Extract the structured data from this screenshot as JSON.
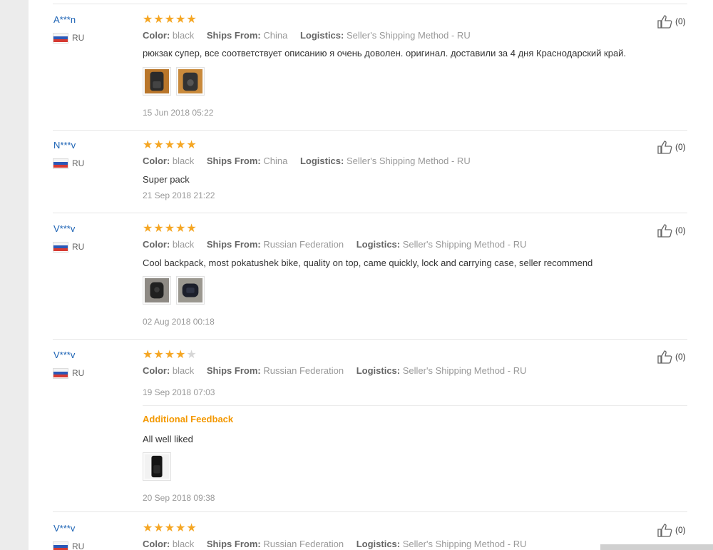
{
  "labels": {
    "color": "Color:",
    "ships_from": "Ships From:",
    "logistics": "Logistics:",
    "additional_feedback": "Additional Feedback"
  },
  "colors": {
    "star_on": "#f5a623",
    "star_off": "#d6d6d6",
    "username": "#1b62b4",
    "additional_feedback": "#f39800"
  },
  "reviews": [
    {
      "user": "A***n",
      "country": "RU",
      "rating": 5,
      "color": "black",
      "ships_from": "China",
      "logistics": "Seller's Shipping Method - RU",
      "text": "рюкзак супер, все соответствует описанию я очень доволен. оригинал. доставили за 4 дня Краснодарский край.",
      "photo_count": 2,
      "date": "15 Jun 2018 05:22",
      "helpful": "(0)"
    },
    {
      "user": "N***v",
      "country": "RU",
      "rating": 5,
      "color": "black",
      "ships_from": "China",
      "logistics": "Seller's Shipping Method - RU",
      "text": "Super pack",
      "photo_count": 0,
      "date": "21 Sep 2018 21:22",
      "helpful": "(0)"
    },
    {
      "user": "V***v",
      "country": "RU",
      "rating": 5,
      "color": "black",
      "ships_from": "Russian Federation",
      "logistics": "Seller's Shipping Method - RU",
      "text": "Cool backpack, most pokatushek bike, quality on top, came quickly, lock and carrying case, seller recommend",
      "photo_count": 2,
      "date": "02 Aug 2018 00:18",
      "helpful": "(0)"
    },
    {
      "user": "V***v",
      "country": "RU",
      "rating": 4,
      "color": "black",
      "ships_from": "Russian Federation",
      "logistics": "Seller's Shipping Method - RU",
      "date": "19 Sep 2018 07:03",
      "helpful": "(0)",
      "additional_text": "All well liked",
      "additional_photo_count": 1,
      "additional_date": "20 Sep 2018 09:38"
    },
    {
      "user": "V***v",
      "country": "RU",
      "rating": 5,
      "color": "black",
      "ships_from": "Russian Federation",
      "logistics": "Seller's Shipping Method - RU",
      "helpful": "(0)"
    }
  ]
}
